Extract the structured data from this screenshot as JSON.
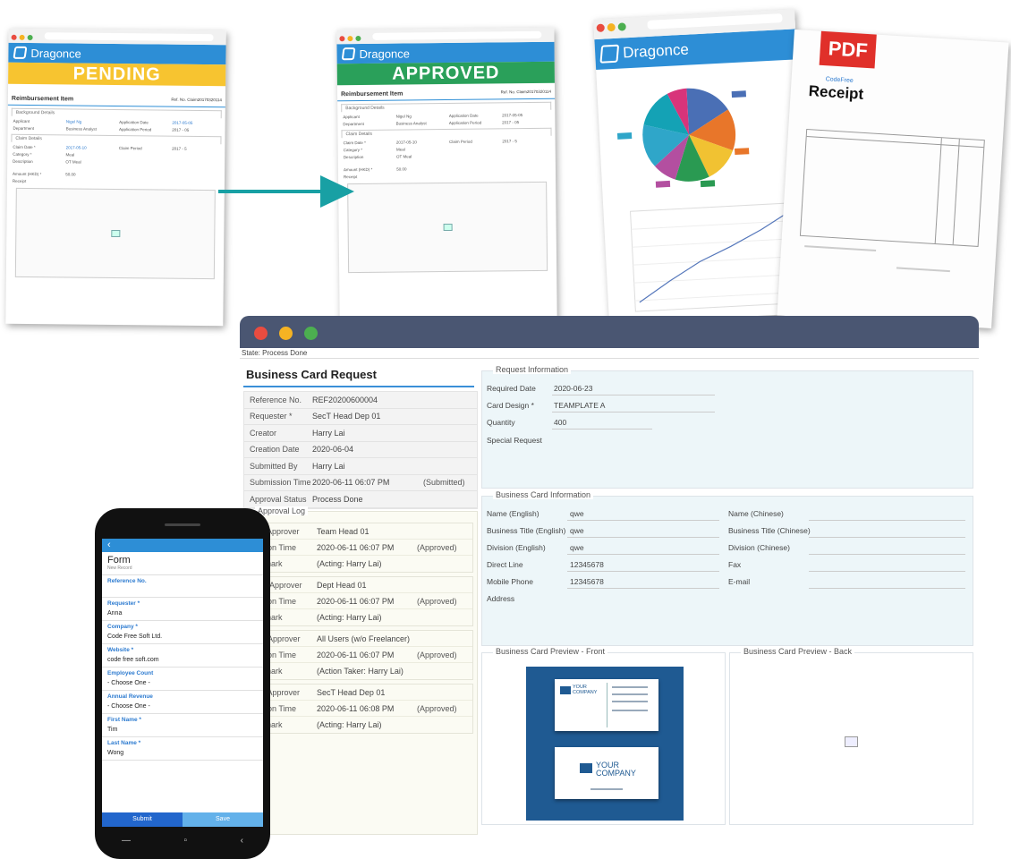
{
  "pending_card": {
    "brand": "Dragonce",
    "banner": "PENDING",
    "form_title": "Reimbursement Item",
    "ref_label": "Ref. No.",
    "ref_value": "Claim20170320114",
    "section_background": "Background Details",
    "applicant_label": "Applicant",
    "applicant_value": "Nigel Ng",
    "application_date_label": "Application Date",
    "application_date_value": "2017-05-05",
    "department_label": "Department",
    "department_value": "Business Analyst",
    "application_period_label": "Application Period",
    "application_period_value": "2017 - 05",
    "section_claim": "Claim Details",
    "claim_date_label": "Claim Date *",
    "claim_date_value": "2017-05-10",
    "claim_period_label": "Claim Period",
    "claim_period_value": "2017 - 5",
    "category_label": "Category *",
    "category_value": "Meal",
    "description_label": "Description",
    "description_value": "OT Meal",
    "amount_label": "Amount (HKD) *",
    "amount_value": "50.00",
    "receipt_label": "Receipt"
  },
  "approved_card": {
    "brand": "Dragonce",
    "banner": "APPROVED",
    "form_title": "Reimbursement Item",
    "ref_label": "Ref. No.",
    "ref_value": "Claim20170320114",
    "section_background": "Background Details",
    "applicant_label": "Applicant",
    "applicant_value": "Nigel Ng",
    "application_date_label": "Application Date",
    "application_date_value": "2017-05-05",
    "department_label": "Department",
    "department_value": "Business Analyst",
    "application_period_label": "Application Period",
    "application_period_value": "2017 - 05",
    "section_claim": "Claim Details",
    "claim_date_label": "Claim Date *",
    "claim_date_value": "2017-05-10",
    "claim_period_label": "Claim Period",
    "claim_period_value": "2017 - 5",
    "category_label": "Category *",
    "category_value": "Meal",
    "description_label": "Description",
    "description_value": "OT Meal",
    "amount_label": "Amount (HKD) *",
    "amount_value": "50.00",
    "receipt_label": "Receipt"
  },
  "chart_card": {
    "brand": "Dragonce"
  },
  "pdf_card": {
    "badge": "PDF",
    "doc_title": "Receipt",
    "logo_text": "CodeFree"
  },
  "main_window": {
    "state": "State: Process Done",
    "form_title": "Business Card Request",
    "fields": [
      {
        "label": "Reference No.",
        "value": "REF20200600004",
        "extra": ""
      },
      {
        "label": "Requester *",
        "value": "SecT Head Dep 01",
        "extra": ""
      },
      {
        "label": "Creator",
        "value": "Harry Lai",
        "extra": ""
      },
      {
        "label": "Creation Date",
        "value": "2020-06-04",
        "extra": ""
      },
      {
        "label": "Submitted By",
        "value": "Harry Lai",
        "extra": ""
      },
      {
        "label": "Submission Time",
        "value": "2020-06-11 06:07 PM",
        "extra": "(Submitted)"
      },
      {
        "label": "Approval Status",
        "value": "Process Done",
        "extra": ""
      }
    ],
    "approval_log_title": "Approval Log",
    "approvers": [
      {
        "role_label": "1st Approver",
        "role_value": "Team Head 01",
        "time_label": "Action Time",
        "time_value": "2020-06-11 06:07 PM",
        "status": "(Approved)",
        "remark_label": "Remark",
        "remark_value": "(Acting: Harry Lai)"
      },
      {
        "role_label": "2nd Approver",
        "role_value": "Dept Head 01",
        "time_label": "Action Time",
        "time_value": "2020-06-11 06:07 PM",
        "status": "(Approved)",
        "remark_label": "Remark",
        "remark_value": "(Acting: Harry Lai)"
      },
      {
        "role_label": "3rd Approver",
        "role_value": "All Users (w/o Freelancer)",
        "time_label": "Action Time",
        "time_value": "2020-06-11 06:07 PM",
        "status": "(Approved)",
        "remark_label": "Remark",
        "remark_value": "(Action Taker: Harry Lai)"
      },
      {
        "role_label": "4th Approver",
        "role_value": "SecT Head Dep 01",
        "time_label": "Action Time",
        "time_value": "2020-06-11 06:08 PM",
        "status": "(Approved)",
        "remark_label": "Remark",
        "remark_value": "(Acting: Harry Lai)"
      }
    ],
    "request_info": {
      "title": "Request Information",
      "required_date_label": "Required Date",
      "required_date_value": "2020-06-23",
      "card_design_label": "Card Design *",
      "card_design_value": "TEAMPLATE A",
      "quantity_label": "Quantity",
      "quantity_value": "400",
      "special_request_label": "Special Request"
    },
    "card_info": {
      "title": "Business Card Information",
      "name_en_label": "Name (English)",
      "name_en_value": "qwe",
      "name_zh_label": "Name (Chinese)",
      "title_en_label": "Business Title (English)",
      "title_en_value": "qwe",
      "title_zh_label": "Business Title (Chinese)",
      "division_en_label": "Division (English)",
      "division_en_value": "qwe",
      "division_zh_label": "Division (Chinese)",
      "direct_line_label": "Direct Line",
      "direct_line_value": "12345678",
      "fax_label": "Fax",
      "mobile_label": "Mobile Phone",
      "mobile_value": "12345678",
      "email_label": "E-mail",
      "address_label": "Address"
    },
    "preview_front_title": "Business Card Preview - Front",
    "preview_back_title": "Business Card Preview - Back",
    "card_company_line1": "YOUR",
    "card_company_line2": "COMPANY"
  },
  "phone": {
    "back_icon": "chevron-left-icon",
    "title": "Form",
    "subtitle": "New Record",
    "fields": [
      {
        "label": "Reference No.",
        "value": ""
      },
      {
        "label": "Requester *",
        "value": "Anna"
      },
      {
        "label": "Company *",
        "value": "Code Free Soft Ltd."
      },
      {
        "label": "Website *",
        "value": "code free soft.com"
      },
      {
        "label": "Employee Count",
        "value": "- Choose One -"
      },
      {
        "label": "Annual Revenue",
        "value": "- Choose One -"
      },
      {
        "label": "First Name *",
        "value": "Tim"
      },
      {
        "label": "Last Name *",
        "value": "Wong"
      }
    ],
    "submit_label": "Submit",
    "save_label": "Save"
  },
  "colors": {
    "brand_blue": "#2d8ed6",
    "pending_yellow": "#f7c430",
    "approved_green": "#2aa05a",
    "arrow_teal": "#18a0a4",
    "title_bar": "#4a5672",
    "pdf_red": "#e0302a"
  }
}
